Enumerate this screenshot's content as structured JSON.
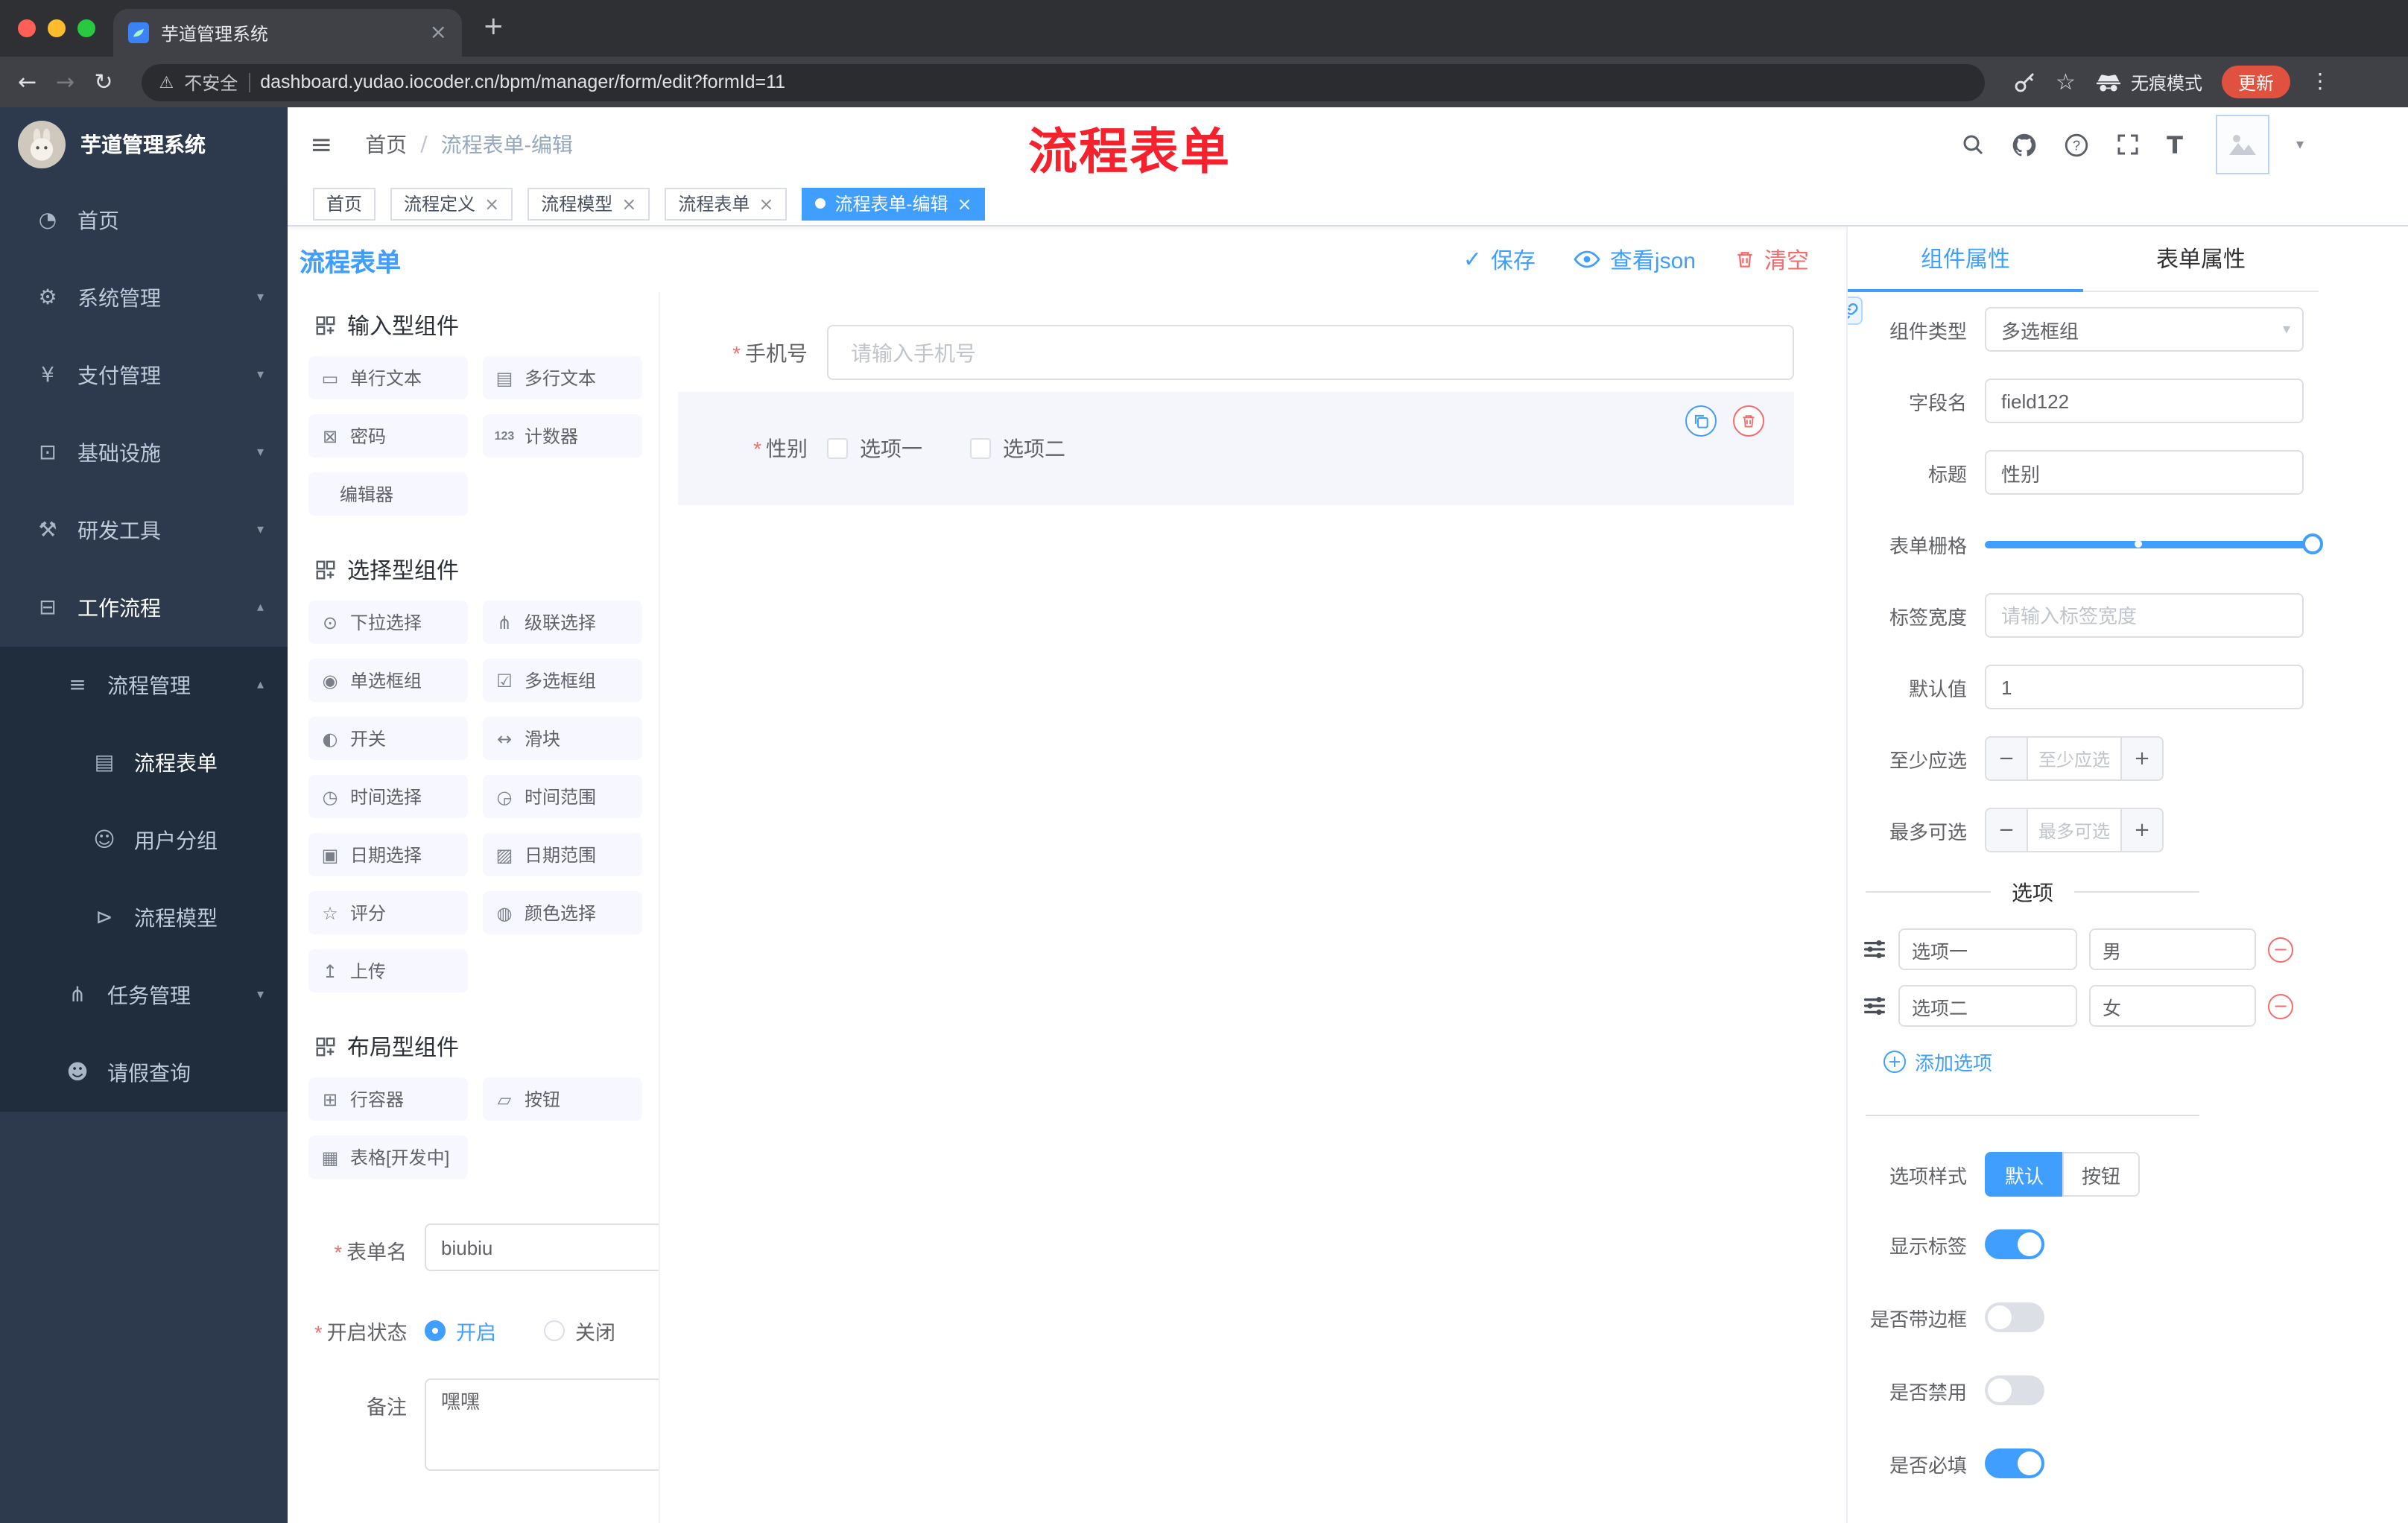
{
  "colors": {
    "accent": "#409eff",
    "danger": "#f56c6c",
    "annotation": "#f5222d",
    "update_badge": "#e0523f",
    "active_tag": "#409eff",
    "sidebar_bg": "#2d3a4d",
    "submenu_bg": "#1f2d3d"
  },
  "glyphs": {
    "asterisk": "*",
    "close": "×",
    "new_tab": "+",
    "back": "←",
    "forward": "→",
    "reload": "↻",
    "warning": "⚠",
    "star": "☆",
    "more": "⋮",
    "minus": "−",
    "plus": "+",
    "caret_down": "▾",
    "caret_up": "▴",
    "check": "✓",
    "slash": "/",
    "text_size": "T",
    "hamburger": "≡"
  },
  "browser": {
    "tab_title": "芋道管理系统",
    "security_label": "不安全",
    "url": "dashboard.yudao.iocoder.cn/bpm/manager/form/edit?formId=11",
    "incognito_label": "无痕模式",
    "update_label": "更新"
  },
  "sidebar": {
    "logo_title": "芋道管理系统",
    "items": [
      {
        "label": "首页",
        "icon": "◔"
      },
      {
        "label": "系统管理",
        "icon": "⚙"
      },
      {
        "label": "支付管理",
        "icon": "¥"
      },
      {
        "label": "基础设施",
        "icon": "⊡"
      },
      {
        "label": "研发工具",
        "icon": "⚒"
      },
      {
        "label": "工作流程",
        "icon": "⊟"
      },
      {
        "label": "流程管理",
        "icon": "≡"
      },
      {
        "label": "流程表单",
        "icon": "▤"
      },
      {
        "label": "用户分组",
        "icon": "☺"
      },
      {
        "label": "流程模型",
        "icon": "⊳"
      },
      {
        "label": "任务管理",
        "icon": "⋔"
      },
      {
        "label": "请假查询",
        "icon": "☻"
      }
    ]
  },
  "header": {
    "breadcrumb": [
      "首页",
      "流程表单-编辑"
    ],
    "annotation": "流程表单"
  },
  "tags": [
    {
      "label": "首页"
    },
    {
      "label": "流程定义"
    },
    {
      "label": "流程模型"
    },
    {
      "label": "流程表单"
    },
    {
      "label": "流程表单-编辑"
    }
  ],
  "designer": {
    "title": "流程表单",
    "actions": {
      "save": "保存",
      "view_json": "查看json",
      "clear": "清空"
    },
    "palette": {
      "sections": [
        {
          "title": "输入型组件",
          "items": [
            {
              "label": "单行文本",
              "icon": "▭"
            },
            {
              "label": "多行文本",
              "icon": "▤"
            },
            {
              "label": "密码",
              "icon": "⊠"
            },
            {
              "label": "计数器",
              "icon": "123"
            },
            {
              "label": "编辑器",
              "icon": ""
            }
          ]
        },
        {
          "title": "选择型组件",
          "items": [
            {
              "label": "下拉选择",
              "icon": "⊙"
            },
            {
              "label": "级联选择",
              "icon": "⋔"
            },
            {
              "label": "单选框组",
              "icon": "◉"
            },
            {
              "label": "多选框组",
              "icon": "☑"
            },
            {
              "label": "开关",
              "icon": "◐"
            },
            {
              "label": "滑块",
              "icon": "↔"
            },
            {
              "label": "时间选择",
              "icon": "◷"
            },
            {
              "label": "时间范围",
              "icon": "◶"
            },
            {
              "label": "日期选择",
              "icon": "▣"
            },
            {
              "label": "日期范围",
              "icon": "▨"
            },
            {
              "label": "评分",
              "icon": "☆"
            },
            {
              "label": "颜色选择",
              "icon": "◍"
            },
            {
              "label": "上传",
              "icon": "↥"
            }
          ]
        },
        {
          "title": "布局型组件",
          "items": [
            {
              "label": "行容器",
              "icon": "⊞"
            },
            {
              "label": "按钮",
              "icon": "▱"
            },
            {
              "label": "表格[开发中]",
              "icon": "▦"
            }
          ]
        }
      ]
    },
    "form_config": {
      "name_label": "表单名",
      "name_value": "biubiu",
      "status_label": "开启状态",
      "status_on": "开启",
      "status_off": "关闭",
      "remark_label": "备注",
      "remark_value": "嘿嘿"
    },
    "canvas": {
      "phone_label": "手机号",
      "phone_placeholder": "请输入手机号",
      "gender_label": "性别",
      "gender_options": [
        "选项一",
        "选项二"
      ]
    }
  },
  "props": {
    "tabs": {
      "component": "组件属性",
      "form": "表单属性"
    },
    "type_label": "组件类型",
    "type_value": "多选框组",
    "field_label": "字段名",
    "field_value": "field122",
    "title_label": "标题",
    "title_value": "性别",
    "grid_label": "表单栅格",
    "width_label": "标签宽度",
    "width_placeholder": "请输入标签宽度",
    "default_label": "默认值",
    "default_value": "1",
    "min_label": "至少应选",
    "min_placeholder": "至少应选",
    "max_label": "最多可选",
    "max_placeholder": "最多可选",
    "options_divider": "选项",
    "options": [
      {
        "name": "选项一",
        "value": "男"
      },
      {
        "name": "选项二",
        "value": "女"
      }
    ],
    "add_option": "添加选项",
    "style_label": "选项样式",
    "style_default": "默认",
    "style_button": "按钮",
    "toggles": [
      {
        "label": "显示标签",
        "on": true
      },
      {
        "label": "是否带边框",
        "on": false
      },
      {
        "label": "是否禁用",
        "on": false
      },
      {
        "label": "是否必填",
        "on": true
      }
    ]
  }
}
